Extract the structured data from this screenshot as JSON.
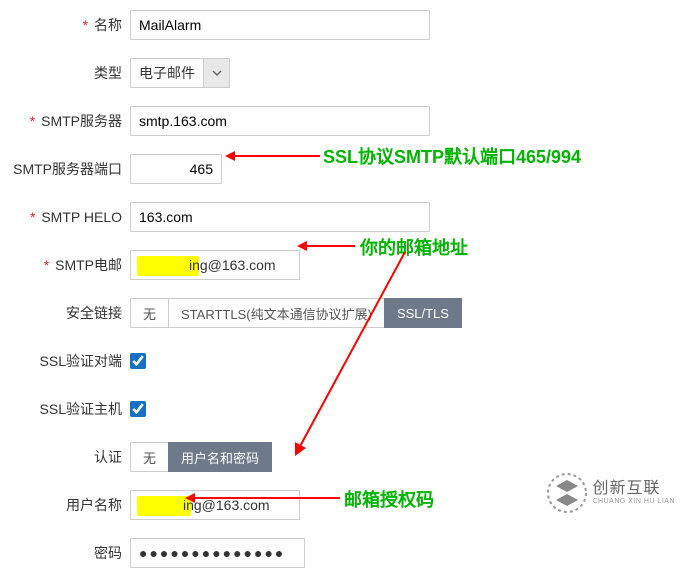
{
  "labels": {
    "name": "名称",
    "type": "类型",
    "smtpServer": "SMTP服务器",
    "smtpPort": "SMTP服务器端口",
    "smtpHelo": "SMTP HELO",
    "smtpEmail": "SMTP电邮",
    "secureConn": "安全链接",
    "sslVerifyPeer": "SSL验证对端",
    "sslVerifyHost": "SSL验证主机",
    "auth": "认证",
    "username": "用户名称",
    "password": "密码"
  },
  "values": {
    "name": "MailAlarm",
    "type": "电子邮件",
    "smtpServer": "smtp.163.com",
    "smtpPort": "465",
    "smtpHelo": "163.com",
    "emailSuffix": "ing@163.com",
    "passwordMasked": "●●●●●●●●●●●●●●"
  },
  "secureOptions": {
    "none": "无",
    "starttls": "STARTTLS(纯文本通信协议扩展)",
    "ssltls": "SSL/TLS"
  },
  "authOptions": {
    "none": "无",
    "userpass": "用户名和密码"
  },
  "checkboxes": {
    "sslVerifyPeer": true,
    "sslVerifyHost": true
  },
  "annotations": {
    "portNote": "SSL协议SMTP默认端口465/994",
    "emailNote": "你的邮箱地址",
    "passwordNote": "邮箱授权码"
  },
  "logo": {
    "cn": "创新互联",
    "en": "CHUANG XIN HU LIAN"
  }
}
